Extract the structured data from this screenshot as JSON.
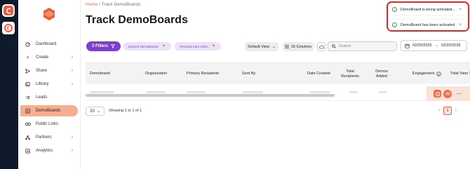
{
  "breadcrumb": {
    "home": "Home",
    "sep": "/",
    "current": "Track DemoBoards"
  },
  "page_title": "Track DemoBoards",
  "sidebar": {
    "items": [
      {
        "label": "Dashboard",
        "icon": "dashboard-icon",
        "chevron": false
      },
      {
        "label": "Create",
        "icon": "plus-icon",
        "chevron": true
      },
      {
        "label": "Share",
        "icon": "share-icon",
        "chevron": true
      },
      {
        "label": "Library",
        "icon": "library-icon",
        "chevron": true
      },
      {
        "label": "Leads",
        "icon": "leads-icon",
        "chevron": false
      },
      {
        "label": "DemoBoards",
        "icon": "demoboards-icon",
        "chevron": false,
        "active": true
      },
      {
        "label": "Public Links",
        "icon": "link-icon",
        "chevron": false
      },
      {
        "label": "Partners",
        "icon": "partners-icon",
        "chevron": true
      },
      {
        "label": "Analytics",
        "icon": "analytics-icon",
        "chevron": true
      }
    ]
  },
  "toolbar": {
    "filters_label": "2 Filters",
    "chips": [
      "Expired DemoBoards",
      "Personal Intro Video"
    ],
    "view_label": "Default View",
    "columns_label": "16 Columns",
    "search_placeholder": "Search",
    "date_from": "02/20/2025",
    "date_to": "02/20/2026"
  },
  "table": {
    "columns": [
      "Demoboard",
      "Organization",
      "Primary Recipients",
      "Sent By",
      "Date Created",
      "Total Recipients",
      "Demos Added",
      "Engagement",
      "Total View Time"
    ]
  },
  "pagination": {
    "page_size": "20",
    "showing": "Showing 1 to 1 of 1",
    "current_page": "1"
  },
  "toasts": [
    {
      "text": "DemoBoard is being activated..."
    },
    {
      "text": "DemoBoard has been activated"
    }
  ],
  "colors": {
    "accent": "#ef5b3a",
    "purple": "#7b3fcf",
    "active_nav": "#f7ae8f",
    "success": "#2e9e5a",
    "highlight_border": "#e02a2a"
  }
}
